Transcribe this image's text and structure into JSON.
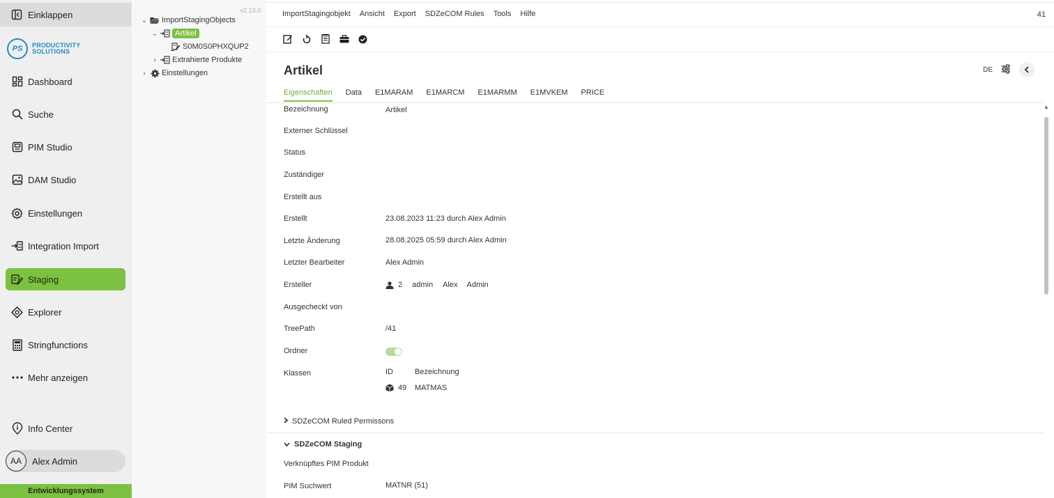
{
  "nav": {
    "collapse_label": "Einklappen",
    "logo": {
      "mark": "PS",
      "line1": "PRODUCTIVITY",
      "line2": "SOLUTIONS"
    },
    "items": [
      {
        "label": "Dashboard",
        "icon": "dashboard-icon"
      },
      {
        "label": "Suche",
        "icon": "search-icon"
      },
      {
        "label": "PIM Studio",
        "icon": "pim-studio-icon"
      },
      {
        "label": "DAM Studio",
        "icon": "image-icon"
      },
      {
        "label": "Einstellungen",
        "icon": "gear-icon"
      },
      {
        "label": "Integration Import",
        "icon": "import-icon"
      },
      {
        "label": "Staging",
        "icon": "staging-icon",
        "active": true
      },
      {
        "label": "Explorer",
        "icon": "explorer-icon"
      },
      {
        "label": "Stringfunctions",
        "icon": "calculator-icon"
      },
      {
        "label": "Mehr anzeigen",
        "icon": "more-icon"
      }
    ],
    "info_center": "Info Center",
    "user": {
      "initials": "AA",
      "name": "Alex Admin"
    },
    "environment": "Entwicklungssystem",
    "accent": "#7cc142"
  },
  "tree": {
    "version": "v2.13.0",
    "root": "ImportStagingObjects",
    "selected": "Artikel",
    "child": "S0M0S0PHXQUP2",
    "extracted": "Extrahierte Produkte",
    "settings": "Einstellungen"
  },
  "menubar": {
    "items": [
      "ImportStagingobjekt",
      "Ansicht",
      "Export",
      "SDZeCOM Rules",
      "Tools",
      "Hilfe"
    ],
    "right": "41"
  },
  "page": {
    "title": "Artikel",
    "language": "DE"
  },
  "tabs": [
    "Eigenschaften",
    "Data",
    "E1MARAM",
    "E1MARCM",
    "E1MARMM",
    "E1MVKEM",
    "PRICE"
  ],
  "fields": {
    "bezeichnung": {
      "label": "Bezeichnung",
      "value": "Artikel"
    },
    "extern": {
      "label": "Externer Schlüssel",
      "value": ""
    },
    "status": {
      "label": "Status",
      "value": ""
    },
    "zustaendiger": {
      "label": "Zuständiger",
      "value": ""
    },
    "erstellt_aus": {
      "label": "Erstellt aus",
      "value": ""
    },
    "erstellt": {
      "label": "Erstellt",
      "value": "23.08.2023 11:23 durch Alex Admin"
    },
    "letzte_aenderung": {
      "label": "Letzte Änderung",
      "value": "28.08.2025 05:59 durch Alex Admin"
    },
    "letzter_bearbeiter": {
      "label": "Letzter Bearbeiter",
      "value": "Alex Admin"
    },
    "ersteller": {
      "label": "Ersteller",
      "id": "2",
      "login": "admin",
      "first": "Alex",
      "last": "Admin"
    },
    "ausgecheckt": {
      "label": "Ausgecheckt von",
      "value": ""
    },
    "treepath": {
      "label": "TreePath",
      "value": "/41"
    },
    "ordner": {
      "label": "Ordner",
      "checked": true
    },
    "klassen": {
      "label": "Klassen",
      "col_id": "ID",
      "col_name": "Bezeichnung",
      "row_id": "49",
      "row_name": "MATMAS"
    }
  },
  "sections": {
    "permissions": "SDZeCOM Ruled Permissons",
    "staging": "SDZeCOM Staging",
    "linked_label": "Verknüpftes PIM Produkt",
    "search_label": "PIM Suchwert",
    "search_value": "MATNR (51)"
  }
}
